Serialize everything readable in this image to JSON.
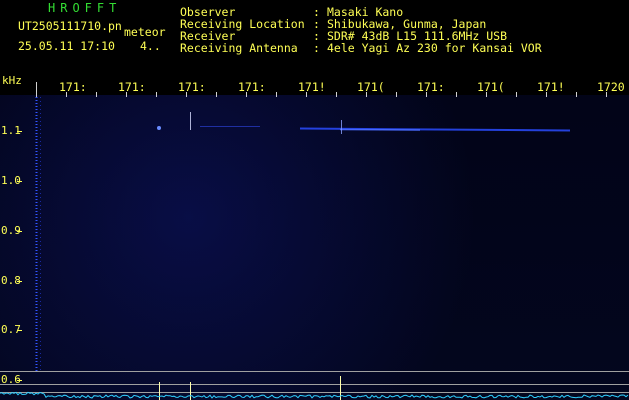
{
  "app": {
    "brand": "HROFFT",
    "filename": "UT2505111710.pn",
    "meteor_label": "meteor",
    "datetime": "25.05.11 17:10",
    "count": "4.."
  },
  "station": {
    "rows": [
      {
        "label": "Observer",
        "value": "Masaki Kano"
      },
      {
        "label": "Receiving Location",
        "value": "Shibukawa, Gunma, Japan"
      },
      {
        "label": "Receiver",
        "value": "SDR# 43dB L15 111.6MHz USB"
      },
      {
        "label": "Receiving Antenna",
        "value": "4ele Yagi Az 230 for Kansai VOR"
      }
    ],
    "separator": ":"
  },
  "spectrogram": {
    "freq_unit": "kHz",
    "time_ticks": [
      "171:",
      "171:",
      "171:",
      "171:",
      "171!",
      "171(",
      "171:",
      "171(",
      "171!",
      "1720"
    ],
    "freq_ticks": [
      "1.1",
      "1.0",
      "0.9",
      "0.8",
      "0.7",
      "0.6"
    ],
    "colors": {
      "axis_text": "#ffff55",
      "grid": "#a0a0a0",
      "signal": "#2a4cff",
      "spectrum": "#30d0ff",
      "meteor": "#ffffaa"
    }
  }
}
